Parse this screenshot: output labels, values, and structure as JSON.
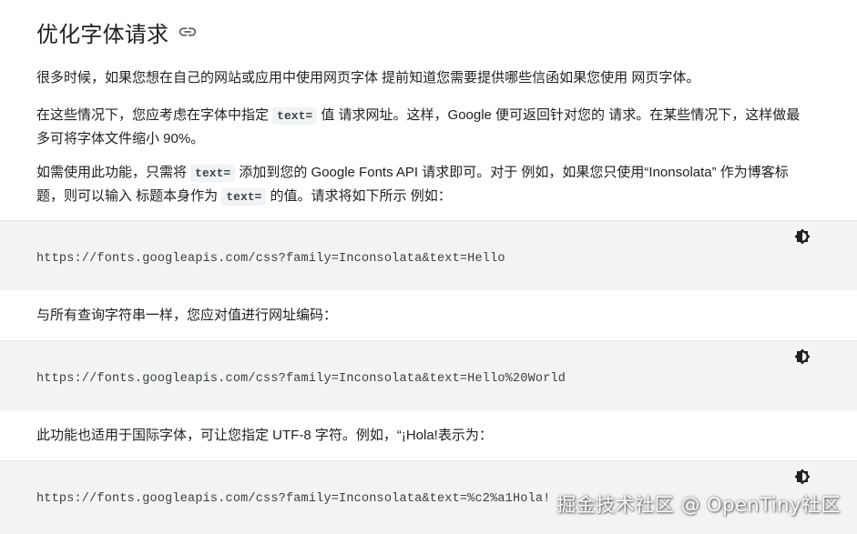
{
  "heading": {
    "title": "优化字体请求",
    "link_icon": "link-icon"
  },
  "paragraphs": {
    "p1": "很多时候，如果您想在自己的网站或应用中使用网页字体 提前知道您需要提供哪些信函如果您使用 网页字体。",
    "p2_before": "在这些情况下，您应考虑在字体中指定 ",
    "p2_code": "text=",
    "p2_after": " 值 请求网址。这样，Google 便可返回针对您的 请求。在某些情况下，这样做最多可将字体文件缩小 90%。",
    "p3_before": "如需使用此功能，只需将 ",
    "p3_code1": "text=",
    "p3_middle": " 添加到您的 Google Fonts API 请求即可。对于 例如，如果您只使用“Inonsolata” 作为博客标题，则可以输入 标题本身作为 ",
    "p3_code2": "text=",
    "p3_after": " 的值。请求将如下所示 例如：",
    "p4": "与所有查询字符串一样，您应对值进行网址编码：",
    "p5": "此功能也适用于国际字体，可让您指定 UTF-8 字符。例如，“¡Hola!表示为："
  },
  "code_blocks": {
    "block1": "https://fonts.googleapis.com/css?family=Inconsolata&text=Hello",
    "block2": "https://fonts.googleapis.com/css?family=Inconsolata&text=Hello%20World",
    "block3": "https://fonts.googleapis.com/css?family=Inconsolata&text=%c2%a1Hola!",
    "theme_icon": "brightness-icon"
  },
  "watermark": "掘金技术社区 @ OpenTiny社区",
  "colors": {
    "code_background": "#f1f3f4",
    "text": "#202124"
  }
}
